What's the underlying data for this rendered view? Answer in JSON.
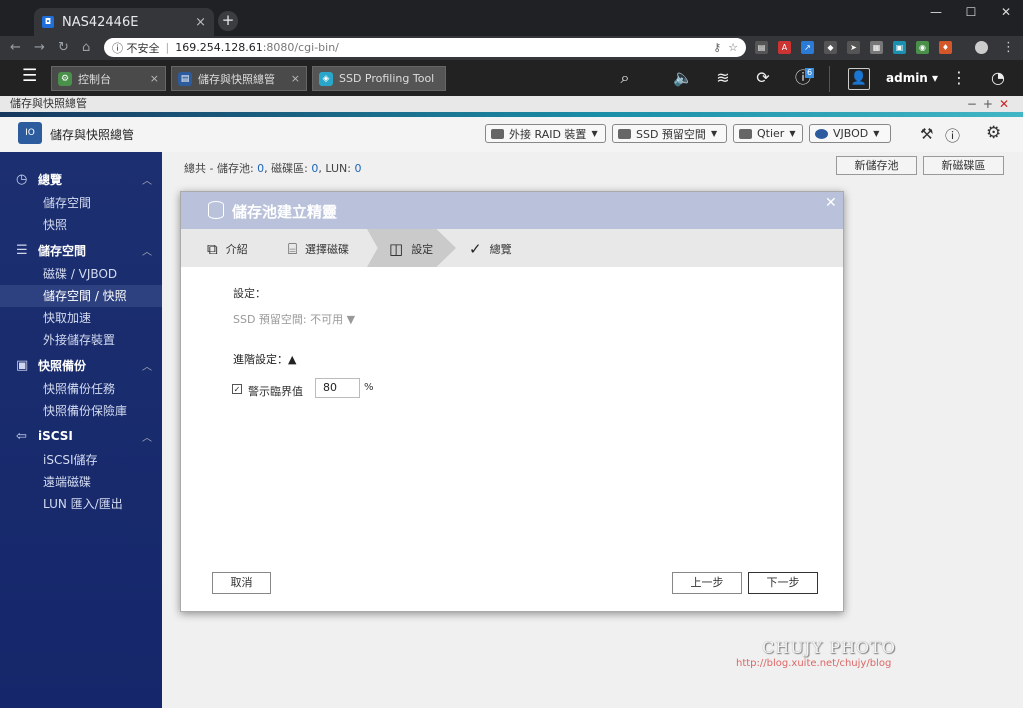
{
  "browser": {
    "tab_title": "NAS42446E",
    "tab_close": "×",
    "new_tab": "+",
    "security_label": "不安全",
    "url_host": "169.254.128.61",
    "url_rest": ":8080/cgi-bin/"
  },
  "qts": {
    "tabs": [
      {
        "label": "控制台",
        "icon": "gear-icon",
        "color": "#4a8f4a"
      },
      {
        "label": "儲存與快照總管",
        "icon": "storage-icon",
        "color": "#2c5c9e"
      },
      {
        "label": "SSD Profiling Tool",
        "icon": "ssd-icon",
        "color": "#2aa6c9"
      }
    ],
    "notification_count": "6",
    "user": "admin"
  },
  "app": {
    "window_title": "儲存與快照總管",
    "header_title": "儲存與快照總管",
    "toolbar": {
      "external_raid": "外接 RAID 裝置",
      "ssd_reserve": "SSD 預留空間",
      "qtier": "Qtier",
      "vjbod": "VJBOD"
    }
  },
  "sidebar": {
    "sections": [
      {
        "label": "總覽",
        "icon": "dashboard-icon",
        "items": [
          "儲存空間",
          "快照"
        ]
      },
      {
        "label": "儲存空間",
        "icon": "database-icon",
        "items": [
          "磁碟 / VJBOD",
          "儲存空間 / 快照",
          "快取加速",
          "外接儲存裝置"
        ]
      },
      {
        "label": "快照備份",
        "icon": "snapshot-icon",
        "items": [
          "快照備份任務",
          "快照備份保險庫"
        ]
      },
      {
        "label": "iSCSI",
        "icon": "iscsi-icon",
        "items": [
          "iSCSI儲存",
          "遠端磁碟",
          "LUN 匯入/匯出"
        ]
      }
    ],
    "active_item": "儲存空間 / 快照"
  },
  "content": {
    "summary_prefix": "總共 - 儲存池: ",
    "pool_count": "0",
    "disk_label": ", 磁碟區: ",
    "disk_count": "0",
    "lun_label": ", LUN: ",
    "lun_count": "0",
    "new_pool_button": "新儲存池",
    "new_volume_button": "新磁碟區"
  },
  "dialog": {
    "title": "儲存池建立精靈",
    "steps": [
      "介紹",
      "選擇磁碟",
      "設定",
      "總覽"
    ],
    "active_step": "設定",
    "settings_label": "設定：",
    "ssd_reserve_label": "SSD 預留空間: 不可用 ▼",
    "advanced_label": "進階設定：▲",
    "alert_threshold_label": "警示臨界值",
    "alert_threshold_checked": true,
    "alert_threshold_value": "80",
    "percent_unit": "%",
    "cancel_button": "取消",
    "back_button": "上一步",
    "next_button": "下一步"
  },
  "watermark": {
    "title": "CHUJY PHOTO",
    "url": "http://blog.xuite.net/chujy/blog"
  }
}
